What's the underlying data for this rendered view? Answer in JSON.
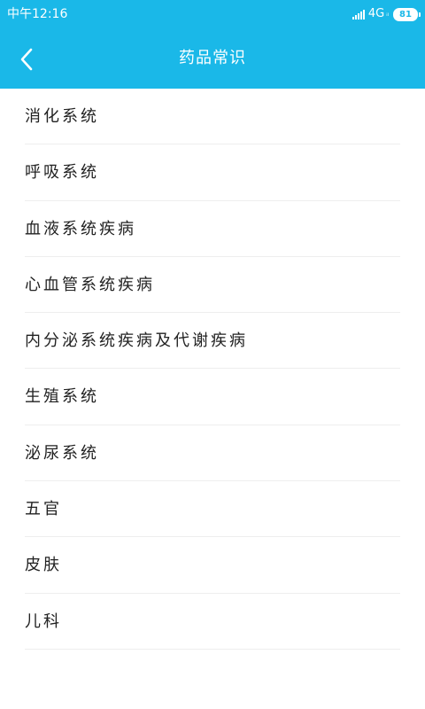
{
  "status_bar": {
    "time": "中午12:16",
    "network": "4G",
    "network_indicator": "ᵢₗ",
    "battery": "81"
  },
  "header": {
    "title": "药品常识",
    "back_icon": "chevron-left-icon",
    "background_color": "#1ab8e8"
  },
  "categories": [
    {
      "label": "消化系统"
    },
    {
      "label": "呼吸系统"
    },
    {
      "label": "血液系统疾病"
    },
    {
      "label": "心血管系统疾病"
    },
    {
      "label": "内分泌系统疾病及代谢疾病"
    },
    {
      "label": "生殖系统"
    },
    {
      "label": "泌尿系统"
    },
    {
      "label": "五官"
    },
    {
      "label": "皮肤"
    },
    {
      "label": "儿科"
    }
  ]
}
